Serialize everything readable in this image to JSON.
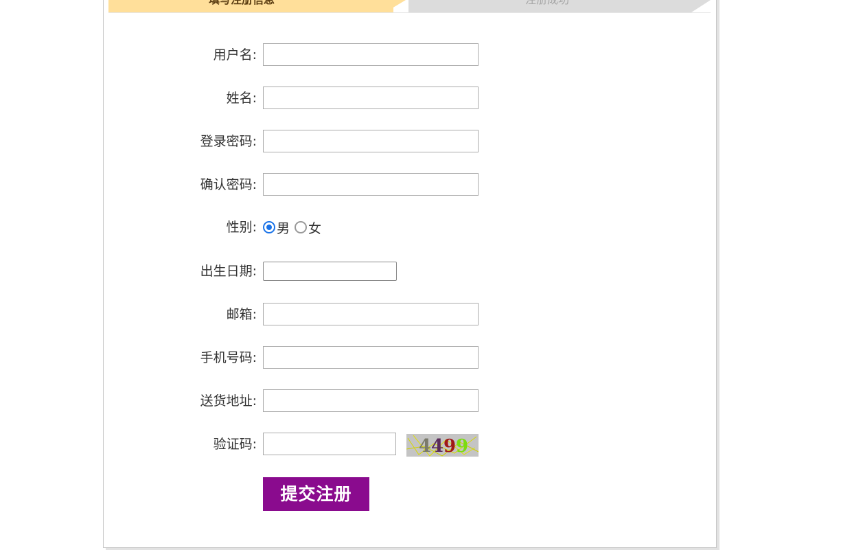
{
  "steps": [
    {
      "label": "填写注册信息",
      "state": "active",
      "color": "#ffdf9a"
    },
    {
      "label": "注册成功",
      "state": "inactive",
      "color": "#dcdcdc"
    }
  ],
  "form": {
    "username": {
      "label": "用户名:",
      "value": ""
    },
    "name": {
      "label": "姓名:",
      "value": ""
    },
    "password": {
      "label": "登录密码:",
      "value": ""
    },
    "confirm_password": {
      "label": "确认密码:",
      "value": ""
    },
    "gender": {
      "label": "性别:",
      "options": [
        {
          "label": "男",
          "checked": true
        },
        {
          "label": "女",
          "checked": false
        }
      ]
    },
    "birthdate": {
      "label": "出生日期:",
      "value": ""
    },
    "email": {
      "label": "邮箱:",
      "value": ""
    },
    "phone": {
      "label": "手机号码:",
      "value": ""
    },
    "address": {
      "label": "送货地址:",
      "value": ""
    },
    "captcha": {
      "label": "验证码:",
      "value": "",
      "image_text": "4499"
    },
    "submit_label": "提交注册"
  },
  "colors": {
    "submit_bg": "#8a0b8e",
    "radio_accent": "#1a73e8"
  }
}
